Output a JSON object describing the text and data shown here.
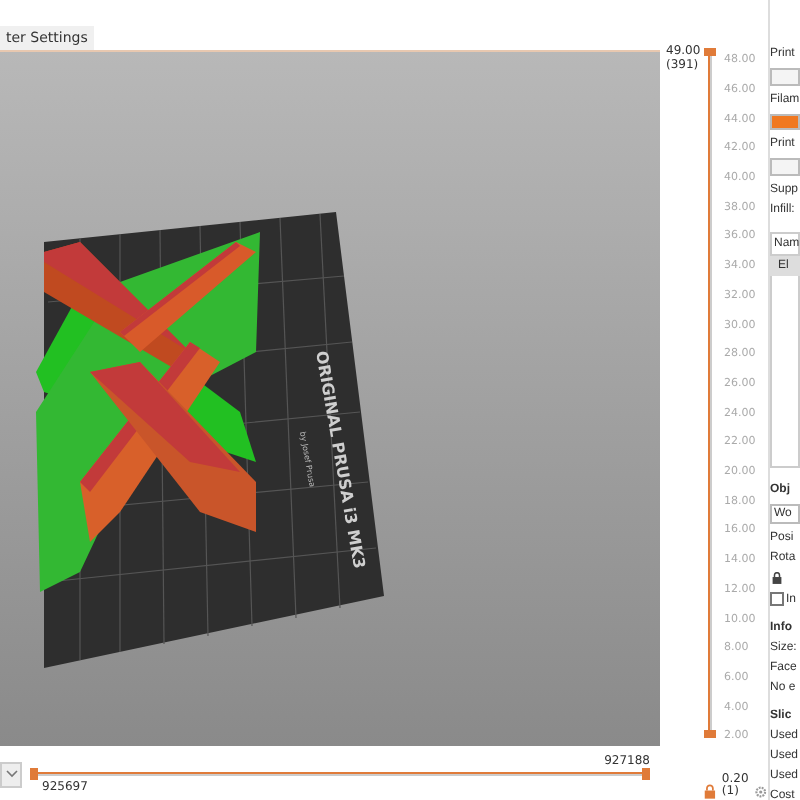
{
  "tabs": [
    {
      "label": "ter Settings",
      "selected": true
    }
  ],
  "vertical_slider": {
    "top_value": "49.00",
    "top_layer": "(391)",
    "level": 1,
    "ticks": [
      "48.00",
      "46.00",
      "44.00",
      "42.00",
      "40.00",
      "38.00",
      "36.00",
      "34.00",
      "32.00",
      "30.00",
      "28.00",
      "26.00",
      "24.00",
      "22.00",
      "20.00",
      "18.00",
      "16.00",
      "14.00",
      "12.00",
      "10.00",
      "8.00",
      "6.00",
      "4.00",
      "2.00"
    ],
    "bottom_value": "0.20",
    "bottom_layer": "(1)"
  },
  "bed_label": {
    "title": "ORIGINAL PRUSA i3 MK3",
    "subtitle": "by Josef Prusa"
  },
  "horizontal_slider": {
    "end_value": "927188",
    "start_value": "925697",
    "level": 1
  },
  "sidebar": {
    "items": [
      {
        "kind": "label",
        "text": "Print"
      },
      {
        "kind": "combo"
      },
      {
        "kind": "label",
        "text": "Filam"
      },
      {
        "kind": "swatch"
      },
      {
        "kind": "label",
        "text": "Print"
      },
      {
        "kind": "combo"
      },
      {
        "kind": "label",
        "text": "Supp"
      },
      {
        "kind": "label",
        "text": "Infill:"
      },
      {
        "kind": "listhead",
        "text": "Nam"
      },
      {
        "kind": "listrow",
        "text": "El"
      },
      {
        "kind": "gap"
      },
      {
        "kind": "heading",
        "text": "Obj"
      },
      {
        "kind": "field",
        "text": "Wo"
      },
      {
        "kind": "label",
        "text": "Posi"
      },
      {
        "kind": "label",
        "text": "Rota"
      },
      {
        "kind": "lock"
      },
      {
        "kind": "check",
        "text": "In",
        "checked": false
      },
      {
        "kind": "heading",
        "text": "Info"
      },
      {
        "kind": "label",
        "text": "Size:"
      },
      {
        "kind": "label",
        "text": "Face"
      },
      {
        "kind": "label",
        "text": "No e"
      },
      {
        "kind": "heading",
        "text": "Slic"
      },
      {
        "kind": "label",
        "text": "Used"
      },
      {
        "kind": "label",
        "text": "Used"
      },
      {
        "kind": "label",
        "text": "Used"
      },
      {
        "kind": "label",
        "text": "Cost"
      }
    ]
  }
}
